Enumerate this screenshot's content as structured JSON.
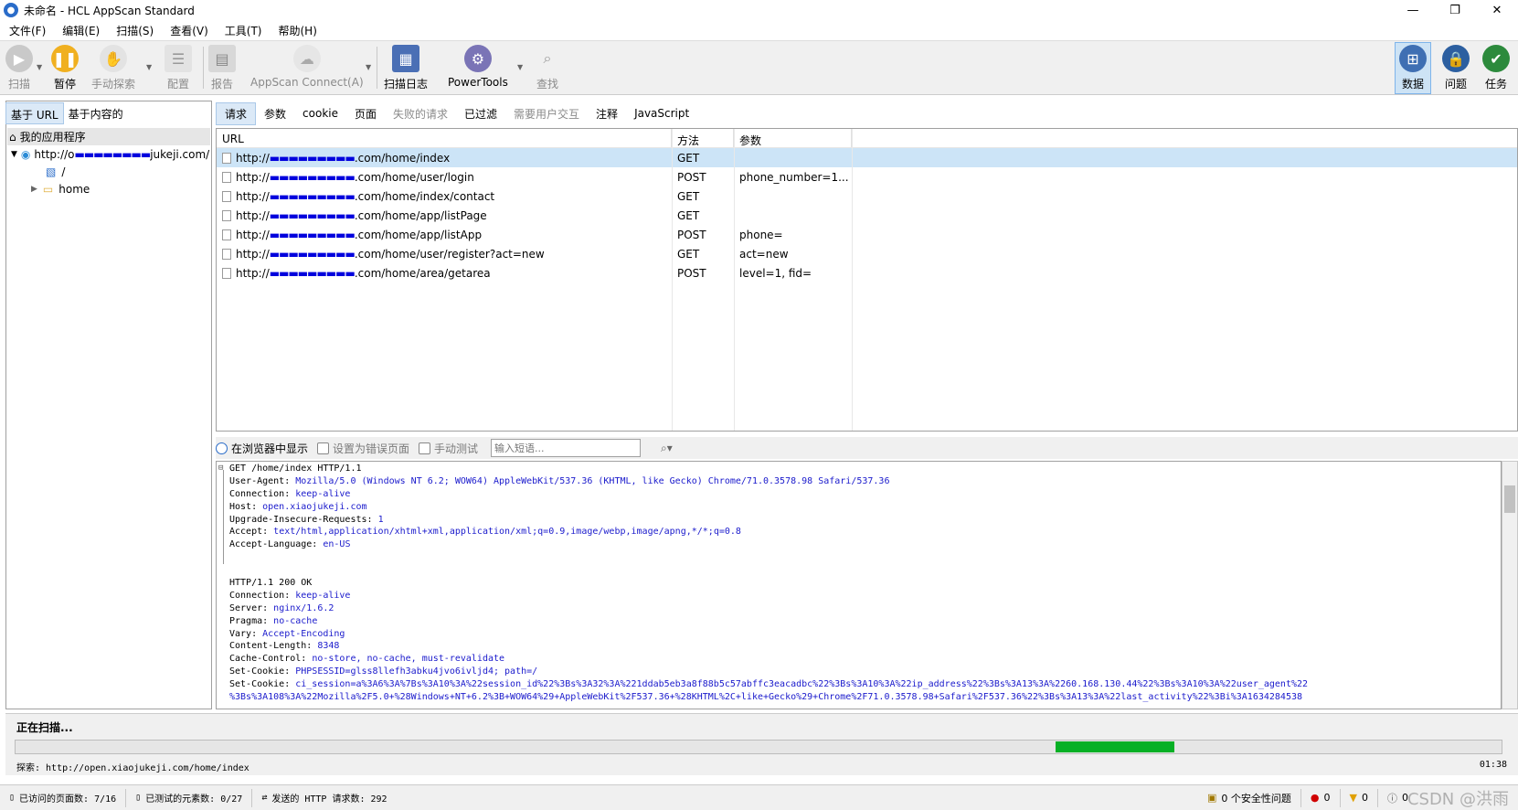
{
  "window": {
    "title": "未命名 - HCL AppScan Standard",
    "min": "—",
    "restore": "❐",
    "close": "✕"
  },
  "menu": [
    "文件(F)",
    "编辑(E)",
    "扫描(S)",
    "查看(V)",
    "工具(T)",
    "帮助(H)"
  ],
  "toolbar": {
    "scan": "扫描",
    "pause": "暂停",
    "manual_explore": "手动探索",
    "config": "配置",
    "report": "报告",
    "appscan_connect": "AppScan Connect(A)",
    "scan_log": "扫描日志",
    "powertools": "PowerTools",
    "find": "查找",
    "data": "数据",
    "issues": "问题",
    "tasks": "任务"
  },
  "left_tabs": [
    "基于 URL",
    "基于内容的"
  ],
  "tree": {
    "root": "我的应用程序",
    "host_prefix": "http://o",
    "host_suffix": "jukeji.com/",
    "child_slash": "/",
    "child_home": "home"
  },
  "request_tabs": [
    {
      "label": "请求",
      "state": "active"
    },
    {
      "label": "参数",
      "state": "normal"
    },
    {
      "label": "cookie",
      "state": "normal"
    },
    {
      "label": "页面",
      "state": "normal"
    },
    {
      "label": "失败的请求",
      "state": "disabled"
    },
    {
      "label": "已过滤",
      "state": "normal"
    },
    {
      "label": "需要用户交互",
      "state": "disabled"
    },
    {
      "label": "注释",
      "state": "normal"
    },
    {
      "label": "JavaScript",
      "state": "normal"
    }
  ],
  "grid": {
    "headers": [
      "URL",
      "方法",
      "参数"
    ],
    "rows": [
      {
        "pre": "http://",
        "path": ".com/home/index",
        "method": "GET",
        "params": ""
      },
      {
        "pre": "http://",
        "path": ".com/home/user/login",
        "method": "POST",
        "params": "phone_number=1..."
      },
      {
        "pre": "http://",
        "path": ".com/home/index/contact",
        "method": "GET",
        "params": ""
      },
      {
        "pre": "http://",
        "path": ".com/home/app/listPage",
        "method": "GET",
        "params": ""
      },
      {
        "pre": "http://",
        "path": ".com/home/app/listApp",
        "method": "POST",
        "params": "phone="
      },
      {
        "pre": "http://",
        "path": ".com/home/user/register?act=new",
        "method": "GET",
        "params": "act=new"
      },
      {
        "pre": "http://",
        "path": ".com/home/area/getarea",
        "method": "POST",
        "params": "level=1, fid="
      }
    ]
  },
  "panel_toolbar": {
    "show_in_browser": "在浏览器中显示",
    "set_error_page": "设置为错误页面",
    "manual_test": "手动测试",
    "search_placeholder": "输入短语..."
  },
  "raw": [
    {
      "k": "GET /home/index HTTP/1.1",
      "v": ""
    },
    {
      "k": "User-Agent: ",
      "v": "Mozilla/5.0 (Windows NT 6.2; WOW64) AppleWebKit/537.36 (KHTML, like Gecko) Chrome/71.0.3578.98 Safari/537.36"
    },
    {
      "k": "Connection: ",
      "v": "keep-alive"
    },
    {
      "k": "Host: ",
      "v": "open.xiaojukeji.com"
    },
    {
      "k": "Upgrade-Insecure-Requests: ",
      "v": "1"
    },
    {
      "k": "Accept: ",
      "v": "text/html,application/xhtml+xml,application/xml;q=0.9,image/webp,image/apng,*/*;q=0.8"
    },
    {
      "k": "Accept-Language: ",
      "v": "en-US"
    },
    {
      "k": "",
      "v": ""
    },
    {
      "k": "",
      "v": ""
    },
    {
      "k": "HTTP/1.1 200 OK",
      "v": ""
    },
    {
      "k": "Connection: ",
      "v": "keep-alive"
    },
    {
      "k": "Server: ",
      "v": "nginx/1.6.2"
    },
    {
      "k": "Pragma: ",
      "v": "no-cache"
    },
    {
      "k": "Vary: ",
      "v": "Accept-Encoding"
    },
    {
      "k": "Content-Length: ",
      "v": "8348"
    },
    {
      "k": "Cache-Control: ",
      "v": "no-store, no-cache, must-revalidate"
    },
    {
      "k": "Set-Cookie: ",
      "v": "PHPSESSID=glss8llefh3abku4jvo6ivljd4; path=/"
    },
    {
      "k": "Set-Cookie: ",
      "v": "ci_session=a%3A6%3A%7Bs%3A10%3A%22session_id%22%3Bs%3A32%3A%221ddab5eb3a8f88b5c57abffc3eacadbc%22%3Bs%3A10%3A%22ip_address%22%3Bs%3A13%3A%2260.168.130.44%22%3Bs%3A10%3A%22user_agent%22"
    },
    {
      "k": "",
      "v": "%3Bs%3A108%3A%22Mozilla%2F5.0+%28Windows+NT+6.2%3B+WOW64%29+AppleWebKit%2F537.36+%28KHTML%2C+like+Gecko%29+Chrome%2F71.0.3578.98+Safari%2F537.36%22%3Bs%3A13%3A%22last_activity%22%3Bi%3A1634284538"
    }
  ],
  "scan": {
    "status": "正在扫描...",
    "progress": 0.7,
    "progress_width": 0.08,
    "url": "探索: http://open.xiaojukeji.com/home/index",
    "time": "01:38"
  },
  "statusbar": {
    "visited": "已访问的页面数: 7/16",
    "tested": "已测试的元素数: 0/27",
    "requests": "发送的 HTTP 请求数: 292",
    "security": "0 个安全性问题",
    "red": "0",
    "warn": "0",
    "info": "0"
  },
  "watermark": "CSDN @洪雨"
}
